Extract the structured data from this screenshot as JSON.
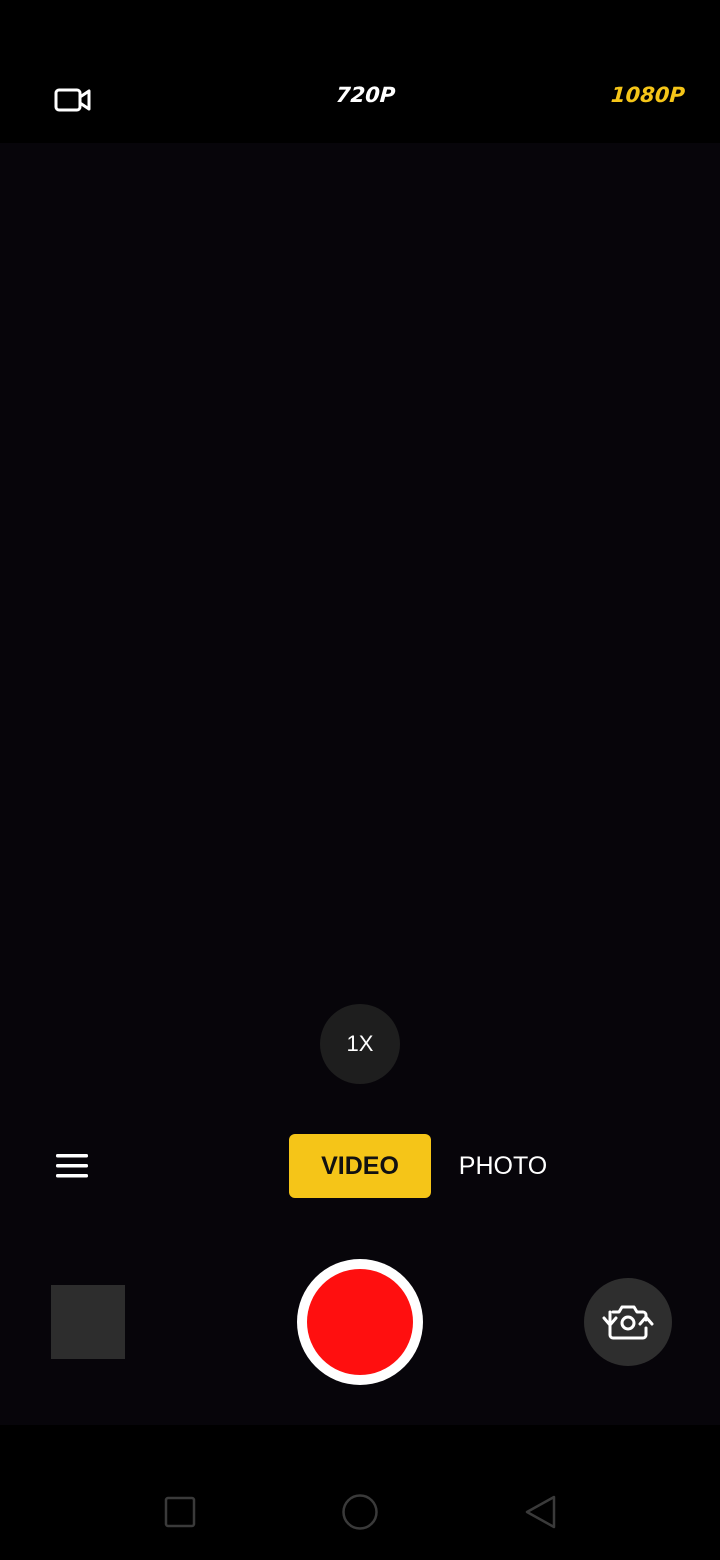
{
  "top_bar": {
    "mode_icon": "video-camera-icon",
    "resolutions": [
      {
        "label": "720P",
        "selected": false
      },
      {
        "label": "1080P",
        "selected": true
      }
    ]
  },
  "zoom": {
    "label": "1X"
  },
  "mode_tabs": [
    {
      "label": "VIDEO",
      "selected": true
    },
    {
      "label": "PHOTO",
      "selected": false
    }
  ],
  "controls": {
    "menu_icon": "hamburger-menu-icon",
    "record_icon": "record-icon",
    "switch_camera_icon": "switch-camera-icon"
  },
  "nav": {
    "recents_icon": "recents-square-icon",
    "home_icon": "home-circle-icon",
    "back_icon": "back-triangle-icon"
  },
  "colors": {
    "accent": "#f5c518",
    "record": "#ff0f0f",
    "background": "#000000"
  }
}
